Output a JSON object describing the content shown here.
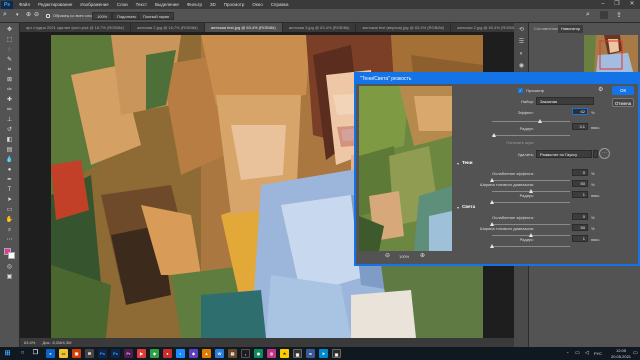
{
  "app": {
    "logo": "Ps"
  },
  "menu": [
    "Файл",
    "Редактирование",
    "Изображение",
    "Слои",
    "Текст",
    "Выделение",
    "Фильтр",
    "3D",
    "Просмотр",
    "Окно",
    "Справка"
  ],
  "window_controls": {
    "minimize": "–",
    "maximize": "❐",
    "close": "✕"
  },
  "options_bar": {
    "sample_all_layers": "Образец со всех слоев",
    "zoom": "100%",
    "fit": "Подогнать",
    "fill": "Полный экран"
  },
  "tabs": [
    {
      "label": "арт студия 2021 сделал фото.psd @ 16,7% (RGB/8#)",
      "active": false
    },
    {
      "label": "женская 2.jpg @ 16,7% (RGB/8#)",
      "active": false
    },
    {
      "label": "женская test.jpg @ 63,4% (RGB/8#)",
      "active": true
    },
    {
      "label": "женская 3.jpg @ 63,4% (RGB/8#)",
      "active": false
    },
    {
      "label": "женская test (версия).jpg @ 63,4% (RGB/8#)",
      "active": false
    },
    {
      "label": "женская 2.jpg @ 63,4% (RGB/8#)",
      "active": false
    }
  ],
  "status": {
    "zoom": "63,4%",
    "doc": "Док.: 8,2M/4,3M"
  },
  "panels": {
    "tab1": "Составление",
    "tab2": "Навигатор",
    "zoom": "63,4%"
  },
  "dialog": {
    "title": "\"Тени/Света\" резкость",
    "preview_label": "Просмотр",
    "preset_label": "Набор:",
    "preset_value": "Заказная",
    "amount_label": "Эффект:",
    "amount_value": "62",
    "radius_label": "Радиус:",
    "radius_value": "3,1",
    "radius_unit": "пикс.",
    "threshold_label": "Понизить шум:",
    "remove_label": "Удалить:",
    "remove_value": "Размытие по Гауссу",
    "ok": "ОК",
    "cancel": "Отмена",
    "preview_zoom": "100%",
    "shadows": {
      "title": "Тени",
      "fade_label": "Ослабление эффекта:",
      "fade_value": "0",
      "fade_unit": "%",
      "tonal_label": "Ширина тонового диапазона:",
      "tonal_value": "50",
      "tonal_unit": "%",
      "radius_label": "Радиус:",
      "radius_value": "1",
      "radius_unit": "пикс."
    },
    "highlights": {
      "title": "Света",
      "fade_label": "Ослабление эффекта:",
      "fade_value": "0",
      "fade_unit": "%",
      "tonal_label": "Ширина тонового диапазона:",
      "tonal_value": "50",
      "tonal_unit": "%",
      "radius_label": "Радиус:",
      "radius_value": "1",
      "radius_unit": "пикс."
    },
    "sliders": {
      "amount": 0.62,
      "radius": 0.03,
      "shadow_fade": 0,
      "shadow_tonal": 0.5,
      "shadow_radius": 0.01,
      "high_fade": 0,
      "high_tonal": 0.5,
      "high_radius": 0.01
    }
  },
  "clock": {
    "time": "12:05",
    "date": "20.05.2021"
  },
  "taskbar_lang": "РУС",
  "colors": {
    "accent": "#1473e6",
    "panel": "#535353",
    "canvas": "#1e1e1e"
  }
}
